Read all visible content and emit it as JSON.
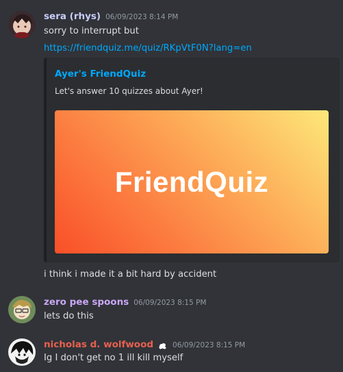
{
  "messages": [
    {
      "username": "sera (rhys)",
      "username_color": "#c9cdfb",
      "timestamp": "06/09/2023 8:14 PM",
      "lines": [
        "sorry to interrupt but"
      ],
      "link": "https://friendquiz.me/quiz/RKpVtF0N?lang=en",
      "after_embed": "i think i made it a bit hard by accident"
    },
    {
      "username": "zero pee spoons",
      "username_color": "#c9a7f5",
      "timestamp": "06/09/2023 8:15 PM",
      "text": "lets do this"
    },
    {
      "username": "nicholas d. wolfwood",
      "username_color": "#e8604f",
      "timestamp": "06/09/2023 8:15 PM",
      "badge_icon": "sheep-icon",
      "text": "Ig I don't get no 1 ill kill myself"
    }
  ],
  "embed": {
    "title": "Ayer's FriendQuiz",
    "description": "Let's answer 10 quizzes about Ayer!",
    "image_text": "FriendQuiz",
    "accent_color": "#1e1f22"
  },
  "colors": {
    "background": "#313338",
    "link": "#00a8fc",
    "timestamp": "#949ba4"
  }
}
